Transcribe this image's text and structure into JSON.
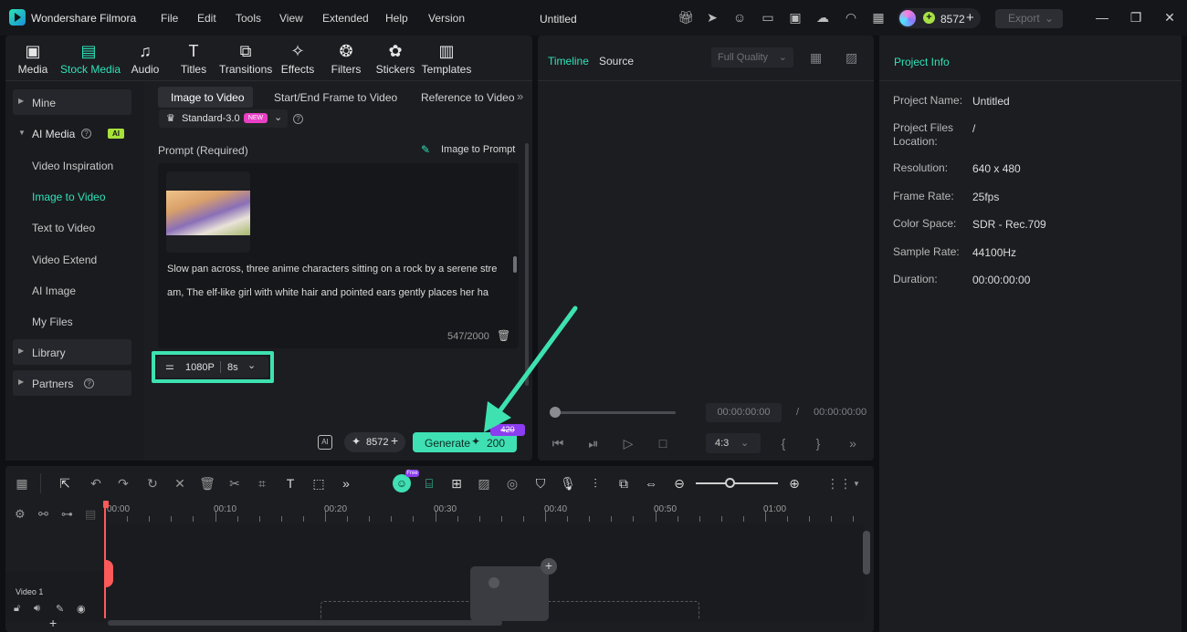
{
  "app": {
    "name": "Wondershare Filmora",
    "menu": [
      "File",
      "Edit",
      "Tools",
      "View",
      "Extended",
      "Help",
      "Version"
    ],
    "window_title": "Untitled",
    "credits": "8572",
    "export_label": "Export"
  },
  "tools": [
    {
      "label": "Media",
      "icon": "media-icon"
    },
    {
      "label": "Stock Media",
      "icon": "stock-media-icon"
    },
    {
      "label": "Audio",
      "icon": "audio-icon"
    },
    {
      "label": "Titles",
      "icon": "titles-icon"
    },
    {
      "label": "Transitions",
      "icon": "transitions-icon"
    },
    {
      "label": "Effects",
      "icon": "effects-icon"
    },
    {
      "label": "Filters",
      "icon": "filters-icon"
    },
    {
      "label": "Stickers",
      "icon": "stickers-icon"
    },
    {
      "label": "Templates",
      "icon": "templates-icon"
    }
  ],
  "sidebar": {
    "mine": "Mine",
    "ai_media": "AI Media",
    "ai_badge": "AI",
    "ai_items": [
      "Video Inspiration",
      "Image to Video",
      "Text to Video",
      "Video Extend",
      "AI Image",
      "My Files"
    ],
    "library": "Library",
    "partners": "Partners"
  },
  "subtabs": [
    "Image to Video",
    "Start/End Frame to Video",
    "Reference to Video"
  ],
  "model": {
    "name": "Standard-3.0",
    "badge": "NEW"
  },
  "prompt": {
    "label": "Prompt (Required)",
    "image_to_prompt": "Image to Prompt",
    "lines": [
      "Slow pan across, three anime characters sitting on a rock by a serene stre",
      "am, The elf-like girl with white hair and pointed ears gently places her ha"
    ],
    "count": "547/2000"
  },
  "options": {
    "resolution": "1080P",
    "duration": "8s"
  },
  "generate": {
    "credits": "8572",
    "label": "Generate",
    "cost": "200",
    "old_cost": "420"
  },
  "preview": {
    "tab_timeline": "Timeline",
    "tab_source": "Source",
    "quality": "Full Quality",
    "current_time": "00:00:00:00",
    "separator": "/",
    "total_time": "00:00:00:00",
    "ratio": "4:3"
  },
  "project_info": {
    "title": "Project Info",
    "rows": [
      {
        "key": "Project Name:",
        "value": "Untitled"
      },
      {
        "key": "Project Files Location:",
        "value": "/"
      },
      {
        "key": "Resolution:",
        "value": "640 x 480"
      },
      {
        "key": "Frame Rate:",
        "value": "25fps"
      },
      {
        "key": "Color Space:",
        "value": "SDR - Rec.709"
      },
      {
        "key": "Sample Rate:",
        "value": "44100Hz"
      },
      {
        "key": "Duration:",
        "value": "00:00:00:00"
      }
    ]
  },
  "timeline": {
    "ticks": [
      "00:00",
      "00:10",
      "00:20",
      "00:30",
      "00:40",
      "00:50",
      "01:00"
    ],
    "track_label": "Video 1",
    "free_badge": "Free"
  },
  "colors": {
    "accent": "#2ee3b8",
    "highlight": "#3de2b0",
    "generate": "#3fe0b4",
    "badge_purple": "#8c3df0"
  }
}
